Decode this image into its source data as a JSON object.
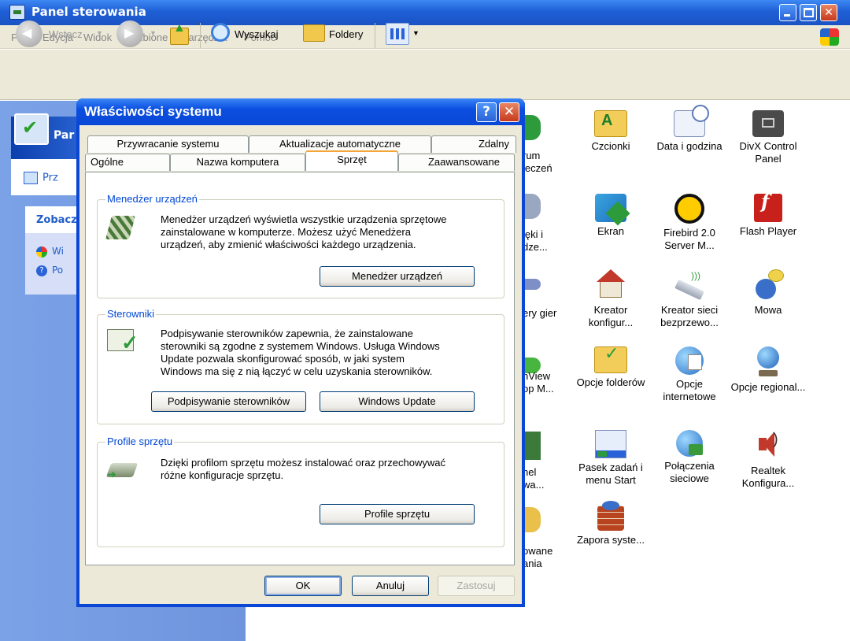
{
  "window": {
    "title": "Panel sterowania"
  },
  "menu": [
    "Plik",
    "Edycja",
    "Widok",
    "Ulubione",
    "Narzędzia",
    "Pomoc"
  ],
  "toolbar": {
    "back_label": "Wstecz",
    "search_label": "Wyszukaj",
    "folders_label": "Foldery"
  },
  "left_pane": {
    "panel_title": "Par",
    "switch_view": "Prz",
    "see_also_title": "Zobacz",
    "links": [
      "Wi",
      "Po"
    ]
  },
  "control_panel_items": [
    {
      "label": "Czcionki",
      "icon": "fonts-folder-icon"
    },
    {
      "label": "Data i godzina",
      "icon": "date-time-icon"
    },
    {
      "label": "DivX Control Panel",
      "icon": "divx-icon"
    },
    {
      "label": "Ekran",
      "icon": "display-icon"
    },
    {
      "label": "Firebird 2.0 Server M...",
      "icon": "firebird-icon"
    },
    {
      "label": "Flash Player",
      "icon": "flash-player-icon"
    },
    {
      "label": "Kreator konfigur...",
      "icon": "network-setup-icon"
    },
    {
      "label": "Kreator sieci bezprzewo...",
      "icon": "wireless-network-icon"
    },
    {
      "label": "Mowa",
      "icon": "speech-icon"
    },
    {
      "label": "Opcje folderów",
      "icon": "folder-options-icon"
    },
    {
      "label": "Opcje internetowe",
      "icon": "internet-options-icon"
    },
    {
      "label": "Opcje regional...",
      "icon": "regional-options-icon"
    },
    {
      "label": "Pasek zadań i menu Start",
      "icon": "taskbar-icon"
    },
    {
      "label": "Połączenia sieciowe",
      "icon": "network-connections-icon"
    },
    {
      "label": "Realtek Konfigura...",
      "icon": "realtek-audio-icon"
    },
    {
      "label": "Zapora syste...",
      "icon": "firewall-icon"
    }
  ],
  "partial_labels": {
    "row1": [
      "rum",
      "ieczeń"
    ],
    "row2": [
      "ięki i",
      "dze..."
    ],
    "row3": [
      "ery gier"
    ],
    "row4": [
      "nView",
      "op M..."
    ],
    "row5": [
      "nel",
      "wa..."
    ],
    "row6": [
      "owane",
      "ania"
    ]
  },
  "dialog": {
    "title": "Właściwości systemu",
    "help": "?",
    "close": "✕",
    "tabs_row1": [
      "Przywracanie systemu",
      "Aktualizacje automatyczne",
      "Zdalny"
    ],
    "tabs_row2": [
      "Ogólne",
      "Nazwa komputera",
      "Sprzęt",
      "Zaawansowane"
    ],
    "active_tab": "Sprzęt",
    "device_manager": {
      "title": "Menedżer urządzeń",
      "text": [
        "Menedżer urządzeń wyświetla wszystkie urządzenia sprzętowe",
        "zainstalowane w komputerze. Możesz użyć Menedżera",
        "urządzeń, aby zmienić właściwości każdego urządzenia."
      ],
      "button": "Menedżer urządzeń"
    },
    "drivers": {
      "title": "Sterowniki",
      "text": [
        "Podpisywanie sterowników zapewnia, że zainstalowane",
        "sterowniki są zgodne z systemem Windows. Usługa Windows",
        "Update pozwala skonfigurować sposób, w jaki system",
        "Windows ma się z nią łączyć w celu uzyskania sterowników."
      ],
      "button_signing": "Podpisywanie sterowników",
      "button_update": "Windows Update"
    },
    "hardware_profiles": {
      "title": "Profile sprzętu",
      "text": [
        "Dzięki profilom sprzętu możesz instalować oraz przechowywać",
        "różne konfiguracje sprzętu."
      ],
      "button": "Profile sprzętu"
    },
    "ok": "OK",
    "cancel": "Anuluj",
    "apply": "Zastosuj"
  }
}
